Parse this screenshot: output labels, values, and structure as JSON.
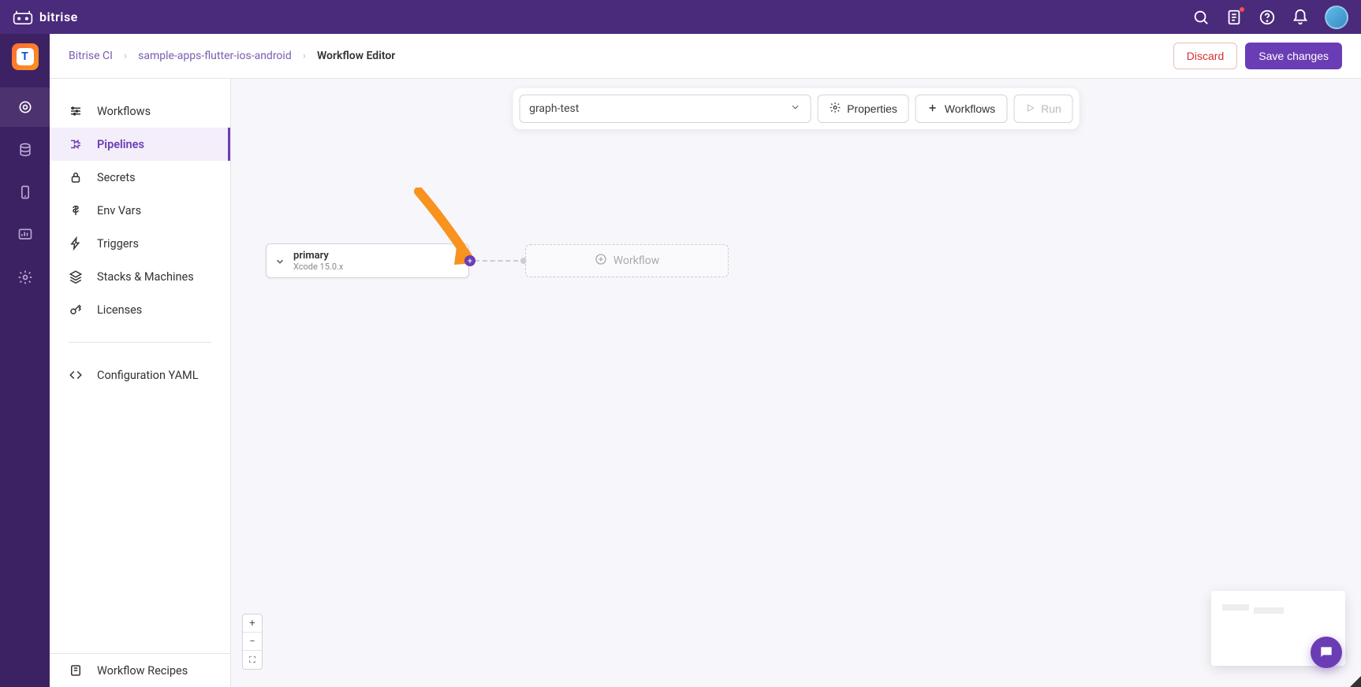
{
  "brand": "bitrise",
  "breadcrumbs": {
    "org": "Bitrise CI",
    "app": "sample-apps-flutter-ios-android",
    "current": "Workflow Editor"
  },
  "actions": {
    "discard": "Discard",
    "save": "Save changes"
  },
  "sidebar": {
    "items": [
      {
        "label": "Workflows"
      },
      {
        "label": "Pipelines"
      },
      {
        "label": "Secrets"
      },
      {
        "label": "Env Vars"
      },
      {
        "label": "Triggers"
      },
      {
        "label": "Stacks & Machines"
      },
      {
        "label": "Licenses"
      }
    ],
    "config_yaml": "Configuration YAML",
    "recipes": "Workflow Recipes"
  },
  "toolbar": {
    "selected_workflow": "graph-test",
    "properties": "Properties",
    "workflows": "Workflows",
    "run": "Run"
  },
  "nodes": {
    "primary": {
      "title": "primary",
      "subtitle": "Xcode 15.0.x"
    },
    "placeholder": "Workflow"
  }
}
